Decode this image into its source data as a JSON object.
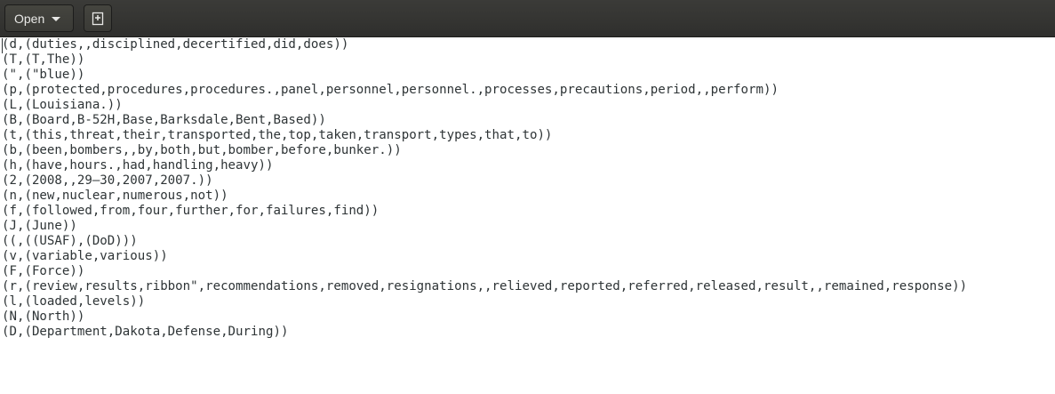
{
  "toolbar": {
    "open_label": "Open",
    "open_icon": "chevron-down-icon",
    "new_document_icon": "new-document-icon"
  },
  "editor": {
    "lines": [
      "(d,(duties,,disciplined,decertified,did,does))",
      "(T,(T,The))",
      "(\",(\"blue))",
      "(p,(protected,procedures,procedures.,panel,personnel,personnel.,processes,precautions,period,,perform))",
      "(L,(Louisiana.))",
      "(B,(Board,B-52H,Base,Barksdale,Bent,Based))",
      "(t,(this,threat,their,transported,the,top,taken,transport,types,that,to))",
      "(b,(been,bombers,,by,both,but,bomber,before,bunker.))",
      "(h,(have,hours.,had,handling,heavy))",
      "(2,(2008,,29–30,2007,2007.))",
      "(n,(new,nuclear,numerous,not))",
      "(f,(followed,from,four,further,for,failures,find))",
      "(J,(June))",
      "((,((USAF),(DoD)))",
      "(v,(variable,various))",
      "(F,(Force))",
      "(r,(review,results,ribbon\",recommendations,removed,resignations,,relieved,reported,referred,released,result,,remained,response))",
      "(l,(loaded,levels))",
      "(N,(North))",
      "(D,(Department,Dakota,Defense,During))"
    ]
  }
}
